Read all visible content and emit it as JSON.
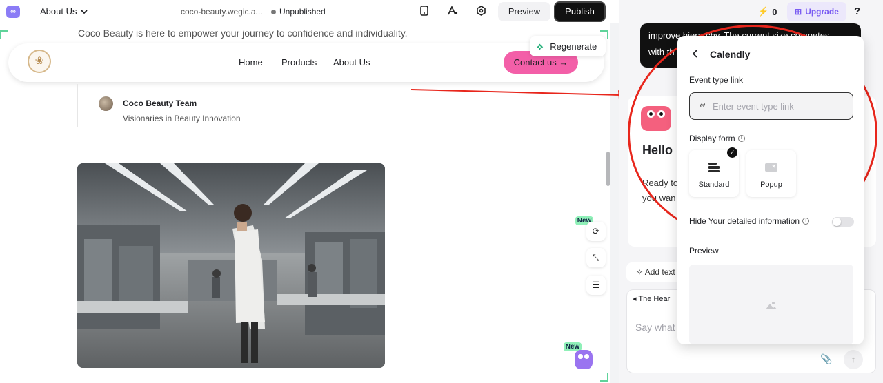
{
  "topbar": {
    "page_switcher_label": "About Us",
    "site_url": "coco-beauty.wegic.a...",
    "publish_status": "Unpublished",
    "preview_label": "Preview",
    "publish_label": "Publish"
  },
  "canvas": {
    "intro_text": "Coco Beauty is here to empower your journey to confidence and individuality.",
    "nav": {
      "links": [
        "Home",
        "Products",
        "About Us"
      ],
      "contact_label": "Contact us"
    },
    "regenerate_label": "Regenerate",
    "author": {
      "name": "Coco Beauty Team",
      "role": "Visionaries in Beauty Innovation"
    },
    "side_tools": {
      "new_badge": "New",
      "new_badge_bottom": "New"
    }
  },
  "right_panel": {
    "credits": "0",
    "upgrade_label": "Upgrade",
    "help_label": "?",
    "dark_message_line1": "improve hierarchy. The current size competes",
    "dark_message_line2": "with th",
    "greeting": "Hello",
    "ready_line1": "Ready to",
    "ready_line2": "you wan",
    "add_text_label": "Add text",
    "heading_chip": "The Hear",
    "chat_placeholder": "Say what"
  },
  "calendly": {
    "title": "Calendly",
    "event_link_label": "Event type link",
    "event_link_placeholder": "Enter event type link",
    "event_link_value": "",
    "display_form_label": "Display form",
    "options": [
      {
        "label": "Standard",
        "selected": true
      },
      {
        "label": "Popup",
        "selected": false
      }
    ],
    "hide_info_label": "Hide Your detailed information",
    "hide_info_enabled": false,
    "preview_label": "Preview"
  },
  "colors": {
    "accent_pink": "#f35fa8",
    "upgrade_purple": "#7a5cf2",
    "annotation_red": "#e8261c",
    "new_badge_green": "#8ff0b8"
  }
}
